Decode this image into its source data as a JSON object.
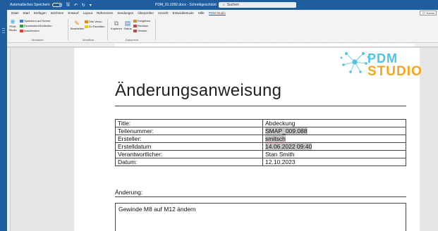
{
  "titlebar": {
    "autosave": "Automatisches Speichern",
    "doc_title": "PDM_01.0282.docx - Schreibgeschützt",
    "search_placeholder": "Suchen"
  },
  "menu": {
    "tabs": [
      "Datei",
      "Start",
      "Einfügen",
      "Zeichnen",
      "Entwurf",
      "Layout",
      "Referenzen",
      "Sendungen",
      "Überprüfen",
      "Ansicht",
      "Entwicklertools",
      "Hilfe",
      "PDM Studio"
    ],
    "active_tab": "PDM Studio",
    "comment_button": "Komm"
  },
  "ribbon": {
    "verwalten": {
      "label": "Verwalten",
      "pdm_studio": "PDM Studio",
      "save_server": "Speichern auf Server",
      "checkin_close": "Einchecken/Schließen",
      "checkout": "Auschecken"
    },
    "workflow": {
      "label": "Workflow",
      "bearbeiten": "Bearbeiten",
      "dirk_versu": "Dirk Versu",
      "zu_favoriten": "Zu Favoriten"
    },
    "dokument": {
      "label": "Dokument",
      "kopieren": "Kopieren",
      "status": "Status",
      "freigeben": "Freigeben",
      "revision": "Revision",
      "version": "Version"
    }
  },
  "document": {
    "title": "Änderungsanweisung",
    "logo_top": "PDM",
    "logo_bottom": "STUDIO",
    "properties": [
      {
        "key": "Title:",
        "value": "Abdeckung",
        "highlight": false
      },
      {
        "key": "Teilenummer:",
        "value": "SMAP_009.088",
        "highlight": true
      },
      {
        "key": "Ersteller:",
        "value": "smitsch",
        "highlight": true,
        "spell": true
      },
      {
        "key": "Erstelldatum",
        "value": "14.06.2022 09:40",
        "highlight": true
      },
      {
        "key": "Verantwortlicher:",
        "value": "Stan Smith",
        "highlight": false
      },
      {
        "key": "Datum:",
        "value": "12.10.2023",
        "highlight": false
      }
    ],
    "change_label": "Änderung:",
    "change_text": "Gewinde M8 auf M12 ändern"
  },
  "colors": {
    "accent": "#1f5d9e",
    "logo_blue": "#4fc3e8",
    "logo_orange": "#f7a51c"
  }
}
